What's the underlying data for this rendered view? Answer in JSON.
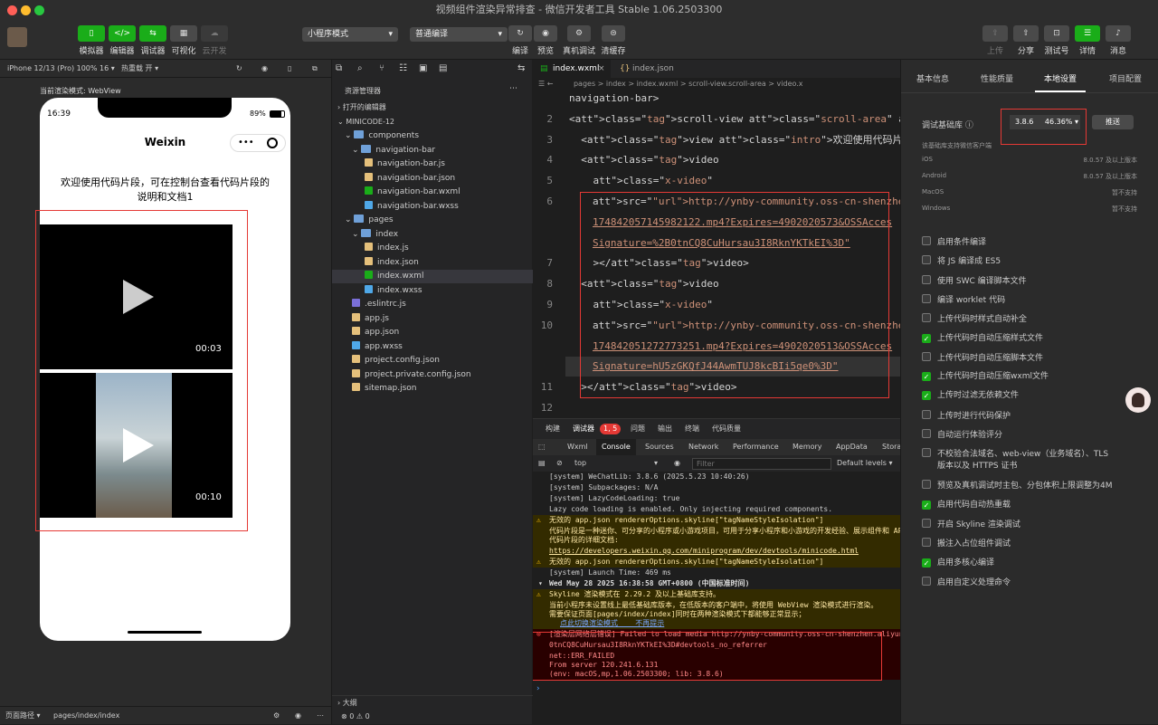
{
  "window": {
    "title": "视频组件渲染异常排查 - 微信开发者工具 Stable 1.06.2503300"
  },
  "toolbar": {
    "left_buttons": [
      "模拟器",
      "编辑器",
      "调试器",
      "可视化",
      "云开发"
    ],
    "mode_select": "小程序模式",
    "compile_select": "普通编译",
    "mid_buttons": [
      "编译",
      "预览",
      "真机调试",
      "清缓存"
    ],
    "right_buttons": [
      "上传",
      "分享",
      "测试号",
      "详情",
      "消息"
    ]
  },
  "simulator": {
    "device": "iPhone 12/13 (Pro) 100% 16 ▾",
    "hot_reload": "热重载 开 ▾",
    "render_mode": "当前渲染模式: WebView",
    "time": "16:39",
    "battery": "89%",
    "nav_title": "Weixin",
    "intro": "欢迎使用代码片段，可在控制台查看代码片段的说明和文档1",
    "video1_time": "00:03",
    "video2_time": "00:10",
    "footer_path_label": "页面路径 ▾",
    "footer_path": "pages/index/index"
  },
  "explorer": {
    "header": "资源管理器",
    "open_editors": "打开的编辑器",
    "project": "MINICODE-12",
    "items": [
      {
        "name": "components",
        "kind": "folder"
      },
      {
        "name": "navigation-bar",
        "kind": "folder"
      },
      {
        "name": "navigation-bar.js",
        "kind": "js"
      },
      {
        "name": "navigation-bar.json",
        "kind": "json"
      },
      {
        "name": "navigation-bar.wxml",
        "kind": "wxml"
      },
      {
        "name": "navigation-bar.wxss",
        "kind": "wxss"
      },
      {
        "name": "pages",
        "kind": "folder"
      },
      {
        "name": "index",
        "kind": "folder"
      },
      {
        "name": "index.js",
        "kind": "js"
      },
      {
        "name": "index.json",
        "kind": "json"
      },
      {
        "name": "index.wxml",
        "kind": "wxml"
      },
      {
        "name": "index.wxss",
        "kind": "wxss"
      },
      {
        "name": ".eslintrc.js",
        "kind": "eslint"
      },
      {
        "name": "app.js",
        "kind": "js"
      },
      {
        "name": "app.json",
        "kind": "json"
      },
      {
        "name": "app.wxss",
        "kind": "wxss"
      },
      {
        "name": "project.config.json",
        "kind": "json"
      },
      {
        "name": "project.private.config.json",
        "kind": "json"
      },
      {
        "name": "sitemap.json",
        "kind": "json"
      }
    ],
    "outline": "大纲",
    "status": "⊗ 0 ⚠ 0"
  },
  "editor": {
    "tabs": [
      "index.wxml",
      "index.json"
    ],
    "breadcrumb": "pages > index > index.wxml > scroll-view.scroll-area > video.x",
    "line_numbers": [
      "",
      "2",
      "3",
      "4",
      "5",
      "6",
      "",
      "",
      "7",
      "8",
      "9",
      "10",
      "",
      "",
      "11",
      "12"
    ],
    "lines": [
      "navigation-bar>",
      "<scroll-view class=\"scroll-area\" type=\"list\" scroll-y>",
      "  <view class=\"intro\">欢迎使用代码片段，可在控制台",
      "  <video",
      "    class=\"x-video\"",
      "    src=\"http://ynby-community.oss-cn-shenzhen.aliyunc",
      "    174842057145982122.mp4?Expires=4902020573&OSSAcces",
      "    Signature=%2B0tnCQ8CuHursau3I8RknYKTkEI%3D\"",
      "    ></video>",
      "  <video",
      "    class=\"x-video\"",
      "    src=\"http://ynby-community.oss-cn-shenzhen.aliyunc",
      "    174842051272773251.mp4?Expires=4902020513&OSSAcces",
      "    Signature=hU5zGKQfJ44AwmTUJ8kcBIi5qe0%3D\"",
      "  ></video>",
      ""
    ]
  },
  "console": {
    "tabs": [
      "构建",
      "调试器",
      "问题",
      "输出",
      "终端",
      "代码质量"
    ],
    "badge": "1, 5",
    "devtabs": [
      "Wxml",
      "Console",
      "Sources",
      "Network",
      "Performance",
      "Memory",
      "AppData",
      "Storage"
    ],
    "context": "top",
    "filter_placeholder": "Filter",
    "levels": "Default levels ▾",
    "lines": [
      "[system] WeChatLib: 3.8.6 (2025.5.23 10:40:26)",
      "[system] Subpackages: N/A",
      "[system] LazyCodeLoading: true",
      "Lazy code loading is enabled. Only injecting required components.",
      "无效的 app.json rendererOptions.skyline[\"tagNameStyleIsolation\"]",
      "代码片段是一种迷你、可分享的小程序或小游戏项目，可用于分享小程序和小游戏的开发经验、展示组件和 API",
      "代码片段的详细文档:",
      "https://developers.weixin.qq.com/miniprogram/dev/devtools/minicode.html",
      "无效的 app.json rendererOptions.skyline[\"tagNameStyleIsolation\"]",
      "[system] Launch Time: 469 ms",
      "Wed May 28 2025 16:38:58 GMT+0800 (中国标准时间)",
      "Skyline 渲染模式在 2.29.2 及以上基础库支持。",
      "当前小程序未设置线上最低基础库版本，在低版本的客户端中，将使用 WebView 渲染模式进行渲染。",
      "需要保证页面[pages/index/index]同时在两种渲染模式下都能够正常显示；",
      "点此切换渲染模式    不再提示",
      "[渲染层网络层错误] Failed to load media http://ynby-community.oss-cn-shenzhen.aliyunc",
      "0tnCQ8CuHursau3I8RknYKTkEI%3D#devtools_no_referrer",
      "net::ERR_FAILED",
      "From server 120.241.6.131",
      "(env: macOS,mp,1.06.2503300; lib: 3.8.6)"
    ]
  },
  "settings": {
    "tabs": [
      "基本信息",
      "性能质量",
      "本地设置",
      "项目配置"
    ],
    "lib_label": "调试基础库",
    "lib_version": "3.8.6",
    "lib_percent": "46.36%",
    "push": "推送",
    "support_note": "该基础库支持微信客户端",
    "platforms": [
      {
        "name": "iOS",
        "value": "8.0.57 及以上版本"
      },
      {
        "name": "Android",
        "value": "8.0.57 及以上版本"
      },
      {
        "name": "MacOS",
        "value": "暂不支持"
      },
      {
        "name": "Windows",
        "value": "暂不支持"
      }
    ],
    "options": [
      {
        "label": "启用条件编译",
        "on": false
      },
      {
        "label": "将 JS 编译成 ES5",
        "on": false
      },
      {
        "label": "使用 SWC 编译脚本文件",
        "on": false
      },
      {
        "label": "编译 worklet 代码",
        "on": false
      },
      {
        "label": "上传代码时样式自动补全",
        "on": false
      },
      {
        "label": "上传代码时自动压缩样式文件",
        "on": true
      },
      {
        "label": "上传代码时自动压缩脚本文件",
        "on": false
      },
      {
        "label": "上传代码时自动压缩wxml文件",
        "on": true
      },
      {
        "label": "上传时过滤无依赖文件",
        "on": true
      },
      {
        "label": "上传时进行代码保护",
        "on": false
      },
      {
        "label": "自动运行体验评分",
        "on": false
      },
      {
        "label": "不校验合法域名、web-view（业务域名）、TLS",
        "on": false
      },
      {
        "label": "预览及真机调试时主包、分包体积上限调整为4M",
        "on": false
      },
      {
        "label": "启用代码自动热重载",
        "on": true
      },
      {
        "label": "开启 Skyline 渲染调试",
        "on": false
      },
      {
        "label": "搬注入占位组件调试",
        "on": false
      },
      {
        "label": "启用多核心编译",
        "on": true
      },
      {
        "label": "启用自定义处理命令",
        "on": false
      }
    ],
    "option_sub": "版本以及 HTTPS 证书"
  },
  "colors": {
    "accent": "#1aad19",
    "highlight": "#e53935"
  }
}
